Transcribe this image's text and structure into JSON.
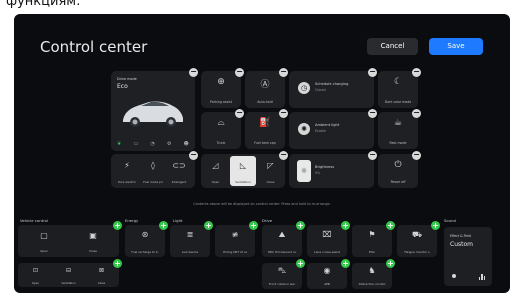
{
  "top_partial_text": "функциям:",
  "header": {
    "title": "Control center",
    "cancel": "Cancel",
    "save": "Save"
  },
  "drive_mode": {
    "label": "Drive mode",
    "value": "Eco"
  },
  "tiles": {
    "parking": "Parking assist",
    "auto_hold": "Auto-hold",
    "schedule": "Schedule charging",
    "schedule_sub": "Closed",
    "dark_mode": "Dark color mode",
    "trunk": "Trunk",
    "fuel_cap": "Fuel tank cap",
    "ambient": "Ambient light",
    "ambient_sub": "Enable",
    "rest_mode": "Rest mode",
    "pure_elec": "Pure electric",
    "fuel_pref": "Fuel mode pri",
    "intelligent": "Intelligent",
    "open": "Open",
    "ventilation": "Ventilation",
    "close": "Close",
    "brightness": "Brightness",
    "brightness_sub": "0%",
    "power_off": "Power off"
  },
  "hint": "Contents above will be displayed on control center. Press and hold to re-arrange.",
  "sections": {
    "vehicle": "Vehicle control",
    "energy": "Energy",
    "light": "Light",
    "drive": "Drive",
    "sound": "Sound"
  },
  "bottom": {
    "vc_open": "Open",
    "vc_close": "Close",
    "vc2_open": "Open",
    "vc2_vent": "Ventilation",
    "vc2_close": "Close",
    "fuel_discharge": "Fuel recharge to b.",
    "low_beams": "Low beams",
    "hiding": "Hiding DRT of ce",
    "hdc": "HDC Hill descent co",
    "lane": "Lane cruise assist",
    "esc": "ESC",
    "fatigue": "Fatigue monitor s",
    "front_collision": "Front collision war",
    "aeb": "AEB",
    "distraction": "Distraction monito"
  },
  "sound": {
    "title": "Effect & Field",
    "value": "Custom"
  },
  "colors": {
    "accent": "#1e7bff",
    "plus": "#35c84b",
    "bg": "#0b0c0f"
  }
}
